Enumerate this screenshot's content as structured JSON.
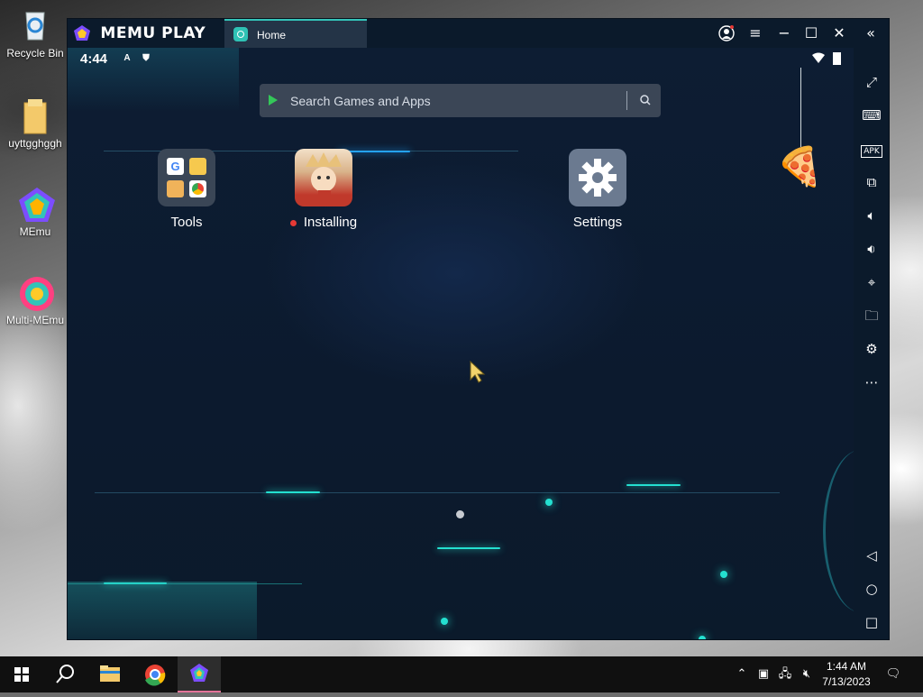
{
  "desktop": {
    "icons": [
      {
        "label": "Recycle Bin",
        "icon": "recycle-bin-icon"
      },
      {
        "label": "uyttgghggh",
        "icon": "folder-icon"
      },
      {
        "label": "MEmu",
        "icon": "memu-icon"
      },
      {
        "label": "Multi-MEmu",
        "icon": "multi-memu-icon"
      }
    ]
  },
  "window": {
    "brand": "MEMU PLAY",
    "tab_label": "Home",
    "controls": [
      "user-icon",
      "menu-icon",
      "minimize-icon",
      "maximize-icon",
      "close-icon",
      "collapse-icon"
    ]
  },
  "android": {
    "status_time": "4:44",
    "search_placeholder": "Search Games and Apps",
    "apps": [
      {
        "label": "Tools",
        "icon": "tools-folder-icon"
      },
      {
        "label": "Installing",
        "icon": "game-install-icon"
      },
      {
        "label": "Settings",
        "icon": "settings-gear-icon"
      }
    ]
  },
  "sidebar": {
    "buttons": [
      "fullscreen-icon",
      "keyboard-icon",
      "apk-icon",
      "multi-window-icon",
      "volume-up-icon",
      "volume-down-icon",
      "location-icon",
      "folder-icon",
      "settings-icon",
      "more-icon"
    ],
    "apk_label": "APK",
    "nav": [
      "back-icon",
      "home-icon",
      "recents-icon"
    ]
  },
  "taskbar": {
    "time": "1:44 AM",
    "date": "7/13/2023",
    "apps": [
      "windows-start-icon",
      "search-icon",
      "file-explorer-icon",
      "chrome-icon",
      "memu-icon"
    ]
  },
  "colors": {
    "accent": "#33c3b8",
    "screen_bg": "#0d1d33",
    "taskbar": "#101010"
  }
}
